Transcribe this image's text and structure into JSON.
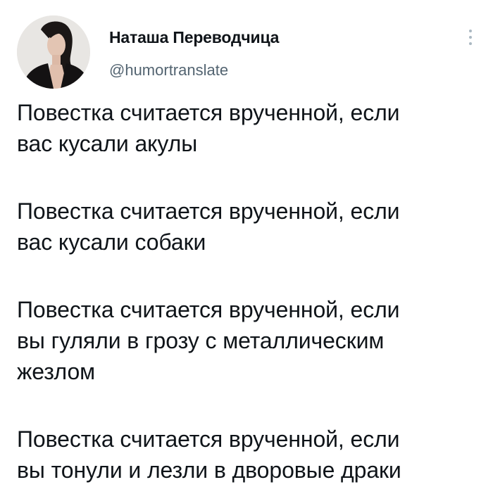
{
  "author": {
    "display_name": "Наташа Переводчица",
    "handle": "@humortranslate",
    "avatar_icon": "profile-photo"
  },
  "more_icon": "more-vertical-icon",
  "tweet": {
    "paragraphs": [
      {
        "lines": [
          "Повестка считается врученной, если",
          "вас кусали акулы"
        ]
      },
      {
        "lines": [
          "Повестка считается врученной, если",
          "вас кусали собаки"
        ]
      },
      {
        "lines": [
          "Повестка считается врученной, если",
          "вы гуляли в грозу с металлическим",
          "жезлом"
        ]
      },
      {
        "lines": [
          "Повестка считается врученной, если",
          "вы тонули и лезли в дворовые драки"
        ]
      }
    ]
  },
  "colors": {
    "text": "#0f1419",
    "secondary_text": "#536471",
    "background": "#ffffff"
  }
}
